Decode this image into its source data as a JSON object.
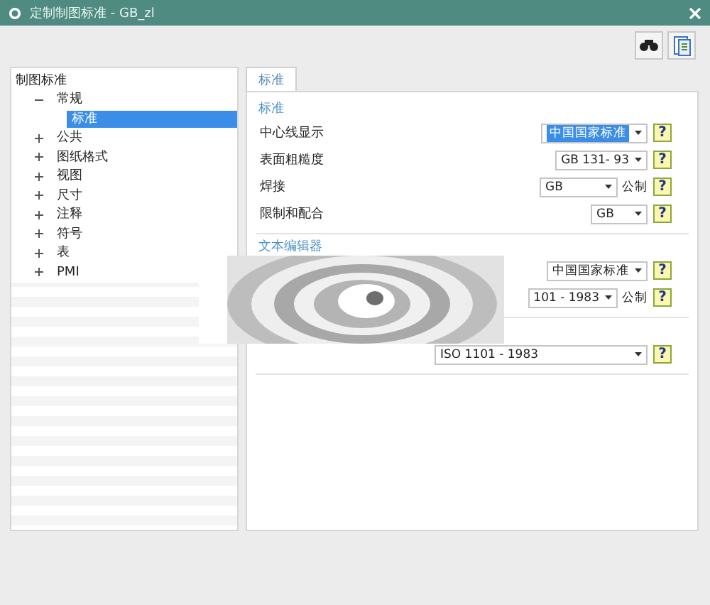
{
  "window": {
    "title": "定制制图标准 - GB_zl"
  },
  "tree": {
    "label": "制图标准",
    "children": [
      {
        "label": "常规",
        "expanded": true,
        "children": [
          {
            "label": "标准",
            "selected": true
          }
        ]
      },
      {
        "label": "公共",
        "expanded": false,
        "selected": false
      },
      {
        "label": "图纸格式",
        "expanded": false,
        "selected": false
      },
      {
        "label": "视图",
        "expanded": false,
        "selected": false
      },
      {
        "label": "尺寸",
        "expanded": false,
        "selected": false
      },
      {
        "label": "注释",
        "expanded": false,
        "selected": false
      },
      {
        "label": "符号",
        "expanded": false,
        "selected": false
      },
      {
        "label": "表",
        "expanded": false,
        "selected": false
      },
      {
        "label": "PMI",
        "expanded": false,
        "selected": false
      }
    ]
  },
  "tabs": [
    {
      "label": "标准",
      "selected": true
    }
  ],
  "sections": [
    {
      "title": "标准",
      "rows": [
        {
          "label": "中心线显示",
          "value": "中国国家标准",
          "focused": true,
          "help": "?"
        },
        {
          "label": "表面粗糙度",
          "value": "GB 131- 93",
          "focused": false,
          "help": "?"
        },
        {
          "label": "焊接",
          "value": "GB",
          "unit": "公制",
          "focused": false,
          "help": "?"
        },
        {
          "label": "限制和配合",
          "value": "GB",
          "focused": false,
          "help": "?"
        }
      ]
    },
    {
      "title": "文本编辑器",
      "rows": [
        {
          "value": "中国国家标准",
          "focused": false,
          "help": "?"
        },
        {
          "value": "101 - 1983",
          "unit": "公制",
          "focused": false,
          "help": "?"
        }
      ]
    },
    {
      "rows": [
        {
          "value": "ISO 1101 - 1983",
          "focused": false,
          "help": "?"
        }
      ]
    }
  ]
}
